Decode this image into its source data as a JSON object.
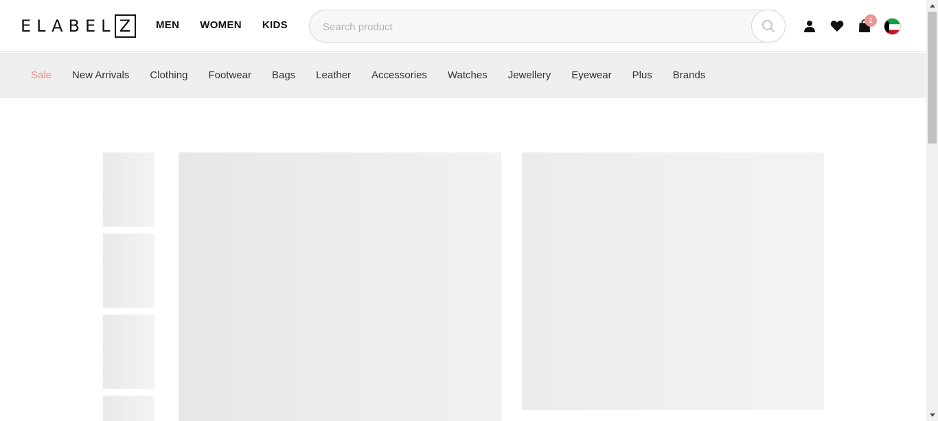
{
  "header": {
    "logo": {
      "letters": "ELABEL",
      "box_letter": "Z"
    },
    "gender_nav": [
      "MEN",
      "WOMEN",
      "KIDS"
    ],
    "search": {
      "placeholder": "Search product",
      "value": ""
    },
    "icons": {
      "search": "search-icon",
      "user": "user-icon",
      "wishlist": "heart-icon",
      "cart": "shopping-bag-icon",
      "country": "kuwait-flag-icon"
    },
    "cart_count": "1"
  },
  "category_nav": {
    "items": [
      "Sale",
      "New Arrivals",
      "Clothing",
      "Footwear",
      "Bags",
      "Leather",
      "Accessories",
      "Watches",
      "Jewellery",
      "Eyewear",
      "Plus",
      "Brands"
    ]
  },
  "colors": {
    "sale_accent": "#e2938d",
    "badge": "#e8968f",
    "nav_background": "#efefef",
    "placeholder_block": "#ececec"
  }
}
